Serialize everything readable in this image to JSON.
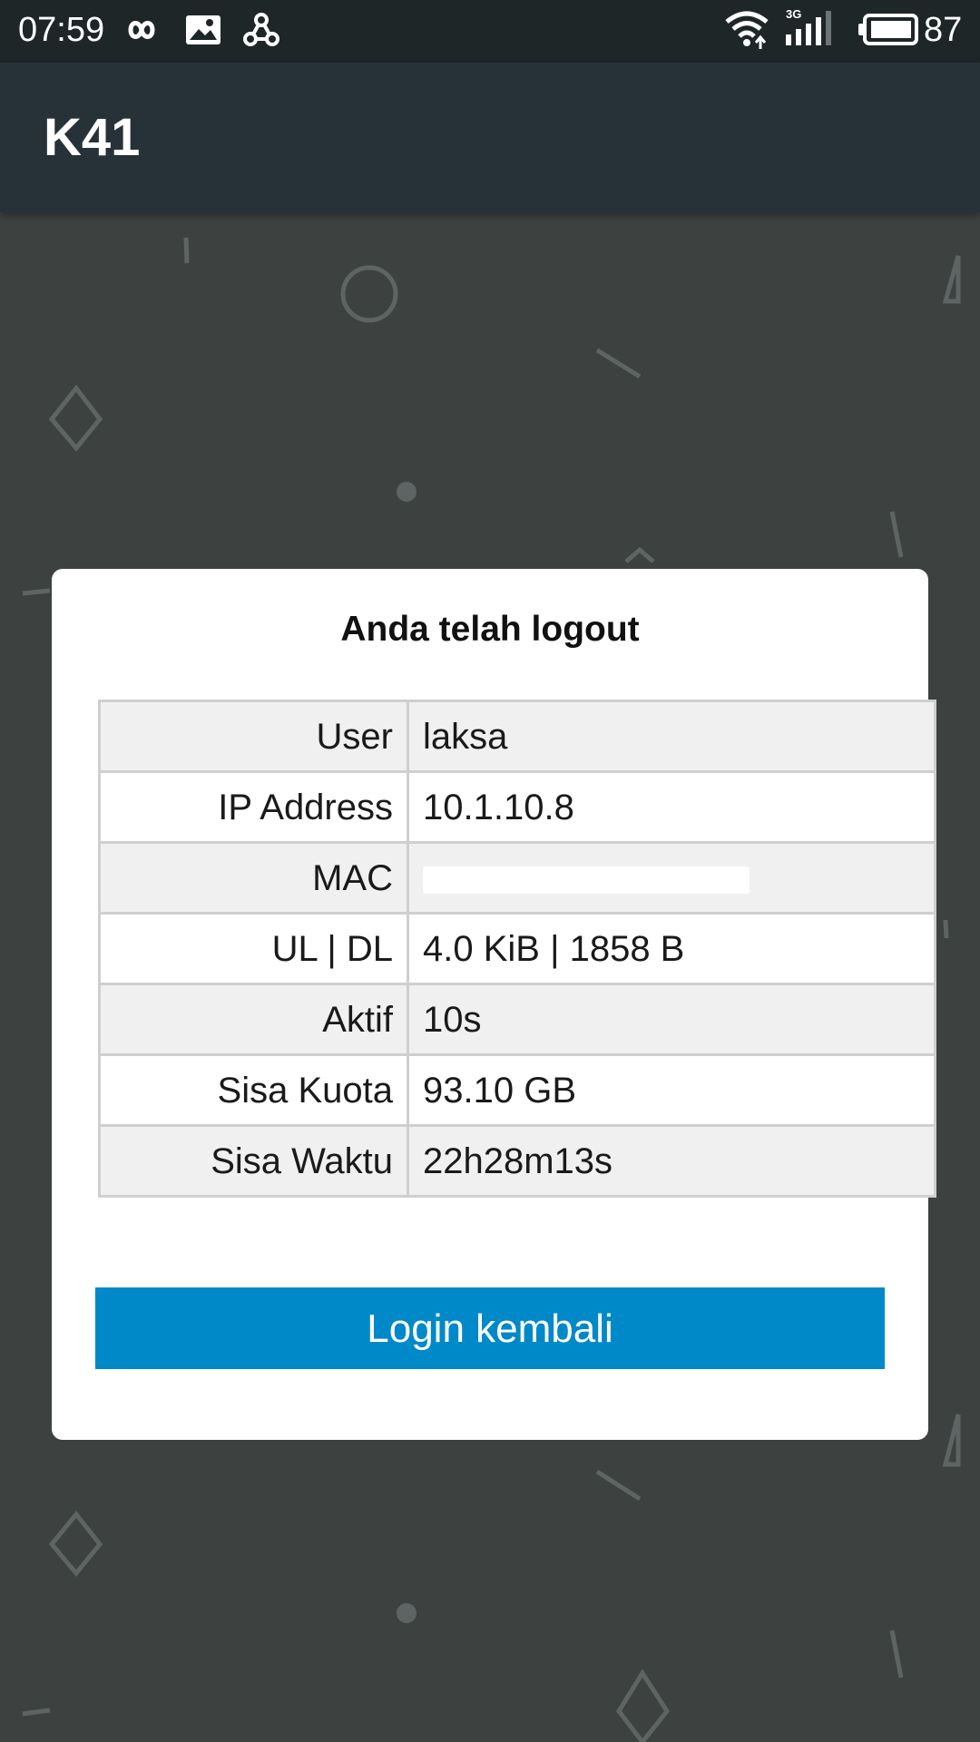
{
  "status_bar": {
    "time": "07:59",
    "network_type": "3G",
    "battery_percent": "87",
    "icons": [
      "infinity-icon",
      "gallery-icon",
      "share-hub-icon",
      "wifi-icon",
      "signal-icon",
      "battery-icon"
    ]
  },
  "app_bar": {
    "title": "K41"
  },
  "dialog": {
    "title": "Anda telah logout",
    "rows": [
      {
        "label": "User",
        "value": "laksa"
      },
      {
        "label": "IP Address",
        "value": "10.1.10.8"
      },
      {
        "label": "MAC",
        "value": ""
      },
      {
        "label": "UL | DL",
        "value": "4.0 KiB | 1858 B"
      },
      {
        "label": "Aktif",
        "value": "10s"
      },
      {
        "label": "Sisa Kuota",
        "value": "93.10 GB"
      },
      {
        "label": "Sisa Waktu",
        "value": "22h28m13s"
      }
    ],
    "button_label": "Login kembali"
  },
  "colors": {
    "background": "#3d4241",
    "status_bar": "#1f2628",
    "app_bar": "#263238",
    "button": "#0089c9",
    "row_alt": "#f0f0f0"
  }
}
